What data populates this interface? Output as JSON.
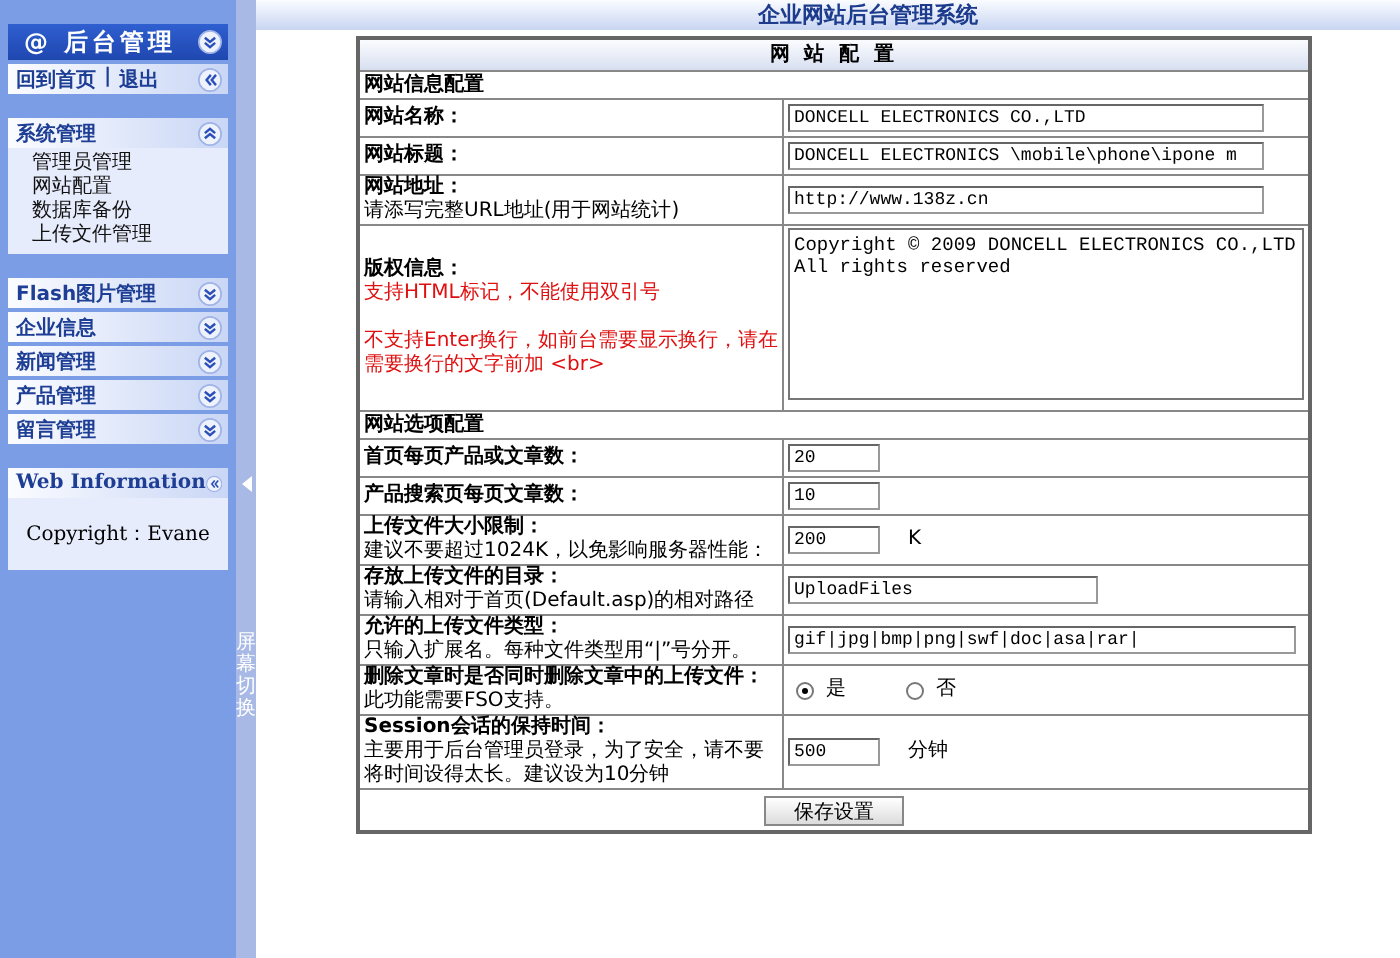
{
  "sidebar": {
    "brand": {
      "symbol": "@",
      "title": "后台管理"
    },
    "links": [
      "回到首页",
      "退出"
    ],
    "link_separator": "|",
    "menus": [
      {
        "title": "系统管理",
        "expanded": true,
        "items": [
          "管理员管理",
          "网站配置",
          "数据库备份",
          "上传文件管理"
        ]
      },
      {
        "title": "Flash图片管理",
        "expanded": false
      },
      {
        "title": "企业信息",
        "expanded": false
      },
      {
        "title": "新闻管理",
        "expanded": false
      },
      {
        "title": "产品管理",
        "expanded": false
      },
      {
        "title": "留言管理",
        "expanded": false
      }
    ],
    "info": {
      "title": "Web Information",
      "text": "Copyright：Evane"
    },
    "toggle_strip": {
      "label": "屏幕切换"
    }
  },
  "header": {
    "title": "企业网站后台管理系统"
  },
  "form": {
    "title": "网 站 配 置",
    "sections": [
      {
        "title": "网站信息配置",
        "rows": [
          {
            "label": "网站名称：",
            "field": {
              "kind": "long",
              "value": "DONCELL ELECTRONICS CO.,LTD"
            }
          },
          {
            "label": "网站标题：",
            "field": {
              "kind": "long",
              "value": "DONCELL ELECTRONICS \\mobile\\phone\\ipone m"
            }
          },
          {
            "label": "网站地址：",
            "notes": [
              {
                "text": "请添写完整URL地址(用于网站统计)",
                "warning": false
              }
            ],
            "field": {
              "kind": "long",
              "value": "http://www.138z.cn"
            }
          },
          {
            "label": "版权信息：",
            "notes": [
              {
                "text": "支持HTML标记，不能使用双引号",
                "warning": true
              },
              {
                "text": "不支持Enter换行，如前台需要显示换行，请在需要换行的文字前加 <br>",
                "warning": true
              }
            ],
            "field": {
              "kind": "textarea",
              "value": "Copyright © 2009 DONCELL ELECTRONICS CO.,LTD All rights reserved"
            }
          }
        ]
      },
      {
        "title": "网站选项配置",
        "rows": [
          {
            "label": "首页每页产品或文章数：",
            "field": {
              "kind": "short",
              "value": "20"
            }
          },
          {
            "label": "产品搜索页每页文章数：",
            "field": {
              "kind": "short",
              "value": "10"
            }
          },
          {
            "label": "上传文件大小限制：",
            "notes": [
              {
                "text": "建议不要超过1024K，以免影响服务器性能：",
                "warning": false
              }
            ],
            "field": {
              "kind": "short",
              "value": "200",
              "unit": "K"
            }
          },
          {
            "label": "存放上传文件的目录：",
            "notes": [
              {
                "text": "请输入相对于首页(Default.asp)的相对路径",
                "warning": false
              }
            ],
            "field": {
              "kind": "medium",
              "value": "UploadFiles"
            }
          },
          {
            "label": "允许的上传文件类型：",
            "notes": [
              {
                "text": "只输入扩展名。每种文件类型用“|”号分开。",
                "warning": false
              }
            ],
            "field": {
              "kind": "wide",
              "value": "gif|jpg|bmp|png|swf|doc|asa|rar|"
            }
          },
          {
            "label": "删除文章时是否同时删除文章中的上传文件：",
            "notes": [
              {
                "text": "此功能需要FSO支持。",
                "warning": false
              }
            ],
            "field": {
              "kind": "radio",
              "options": [
                {
                  "label": "是",
                  "selected": true
                },
                {
                  "label": "否",
                  "selected": false
                }
              ]
            }
          },
          {
            "label": "Session会话的保持时间：",
            "notes": [
              {
                "text": "主要用于后台管理员登录，为了安全，请不要将时间设得太长。建议设为10分钟",
                "warning": false
              }
            ],
            "field": {
              "kind": "short",
              "value": "500",
              "unit": "分钟"
            }
          }
        ]
      }
    ],
    "submit": "保存设置"
  }
}
